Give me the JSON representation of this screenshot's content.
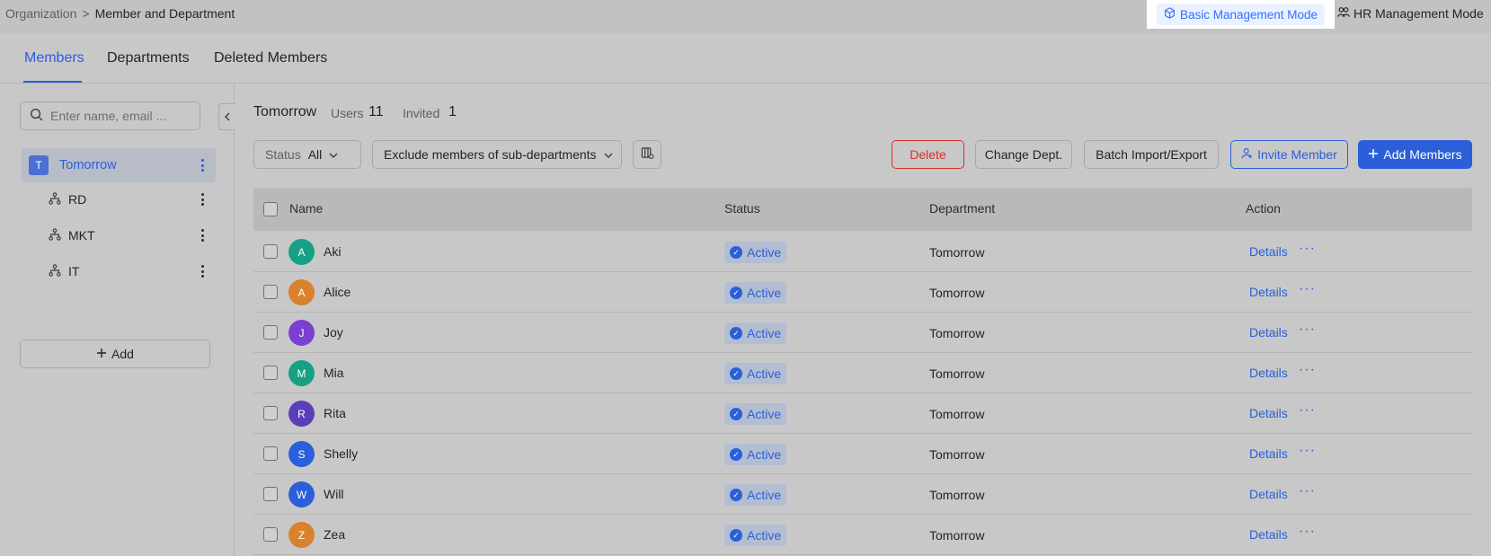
{
  "breadcrumb": {
    "parent": "Organization",
    "separator": ">",
    "current": "Member and Department"
  },
  "modes": {
    "basic": "Basic Management Mode",
    "hr": "HR Management Mode"
  },
  "tabs": [
    {
      "label": "Members",
      "active": true
    },
    {
      "label": "Departments",
      "active": false
    },
    {
      "label": "Deleted Members",
      "active": false
    }
  ],
  "sidebar": {
    "search_placeholder": "Enter name, email ...",
    "root": {
      "initial": "T",
      "label": "Tomorrow"
    },
    "items": [
      {
        "label": "RD"
      },
      {
        "label": "MKT"
      },
      {
        "label": "IT"
      }
    ],
    "add_label": "Add"
  },
  "header": {
    "dept_name": "Tomorrow",
    "users_label": "Users",
    "users_count": "11",
    "invited_label": "Invited",
    "invited_count": "1"
  },
  "filters": {
    "status_label": "Status",
    "status_value": "All",
    "scope_value": "Exclude members of sub-departments"
  },
  "actions": {
    "delete": "Delete",
    "change_dept": "Change Dept.",
    "batch": "Batch Import/Export",
    "invite": "Invite Member",
    "add_members": "Add Members"
  },
  "table": {
    "columns": {
      "name": "Name",
      "status": "Status",
      "department": "Department",
      "action": "Action"
    },
    "details_label": "Details",
    "more_label": "···",
    "rows": [
      {
        "initial": "A",
        "name": "Aki",
        "status": "Active",
        "department": "Tomorrow",
        "color": "#16a085"
      },
      {
        "initial": "A",
        "name": "Alice",
        "status": "Active",
        "department": "Tomorrow",
        "color": "#d9822b"
      },
      {
        "initial": "J",
        "name": "Joy",
        "status": "Active",
        "department": "Tomorrow",
        "color": "#7b3fd1"
      },
      {
        "initial": "M",
        "name": "Mia",
        "status": "Active",
        "department": "Tomorrow",
        "color": "#16a085"
      },
      {
        "initial": "R",
        "name": "Rita",
        "status": "Active",
        "department": "Tomorrow",
        "color": "#5b3fb8"
      },
      {
        "initial": "S",
        "name": "Shelly",
        "status": "Active",
        "department": "Tomorrow",
        "color": "#2b5fd9"
      },
      {
        "initial": "W",
        "name": "Will",
        "status": "Active",
        "department": "Tomorrow",
        "color": "#2b5fd9"
      },
      {
        "initial": "Z",
        "name": "Zea",
        "status": "Active",
        "department": "Tomorrow",
        "color": "#d9822b"
      }
    ]
  }
}
